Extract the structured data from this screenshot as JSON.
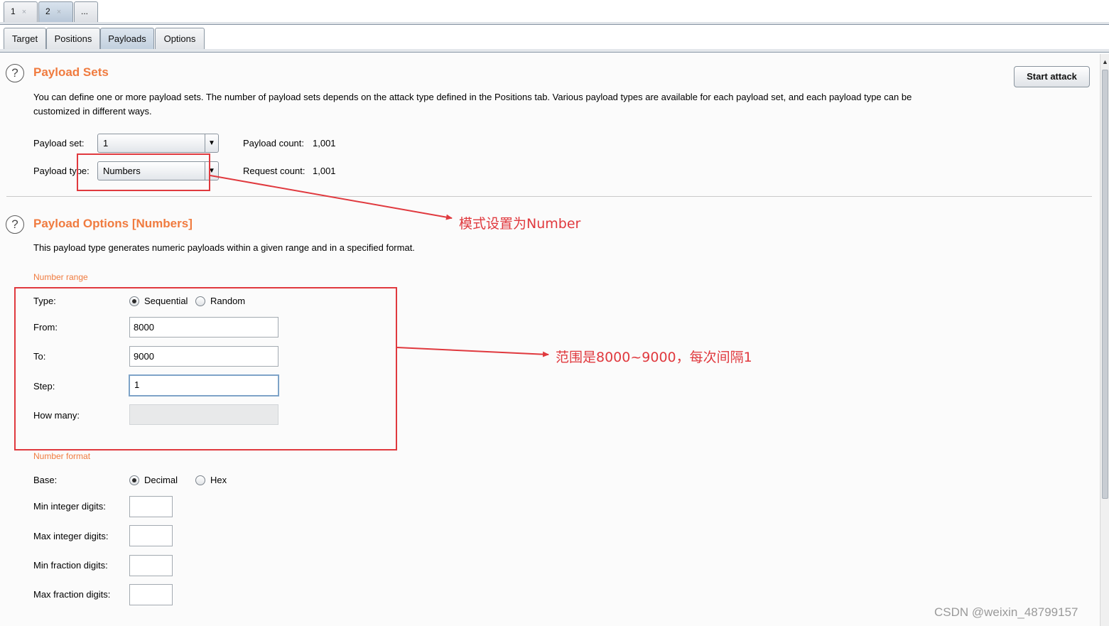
{
  "request_tabs": [
    {
      "label": "1",
      "close": "×"
    },
    {
      "label": "2",
      "close": "×",
      "active": true
    },
    {
      "label": "..."
    }
  ],
  "intruder_tabs": [
    {
      "label": "Target"
    },
    {
      "label": "Positions"
    },
    {
      "label": "Payloads",
      "active": true
    },
    {
      "label": "Options"
    }
  ],
  "payload_sets": {
    "title": "Payload Sets",
    "description_line1": "You can define one or more payload sets. The number of payload sets depends on the attack type defined in the Positions tab. Various payload types are available for each payload set, and each payload type can be",
    "description_line2": "customized in different ways.",
    "payload_set_label": "Payload set:",
    "payload_set_value": "1",
    "payload_type_label": "Payload type:",
    "payload_type_value": "Numbers",
    "payload_count_label": "Payload count:",
    "payload_count_value": "1,001",
    "request_count_label": "Request count:",
    "request_count_value": "1,001",
    "start_attack_label": "Start attack"
  },
  "payload_options": {
    "title": "Payload Options [Numbers]",
    "description": "This payload type generates numeric payloads within a given range and in a specified format.",
    "number_range_heading": "Number range",
    "type_label": "Type:",
    "type_options": [
      "Sequential",
      "Random"
    ],
    "type_selected": "Sequential",
    "from_label": "From:",
    "from_value": "8000",
    "to_label": "To:",
    "to_value": "9000",
    "step_label": "Step:",
    "step_value": "1",
    "how_many_label": "How many:",
    "how_many_value": "",
    "number_format_heading": "Number format",
    "base_label": "Base:",
    "base_options": [
      "Decimal",
      "Hex"
    ],
    "base_selected": "Decimal",
    "min_integer_label": "Min integer digits:",
    "max_integer_label": "Max integer digits:",
    "min_fraction_label": "Min fraction digits:",
    "max_fraction_label": "Max fraction digits:"
  },
  "annotations": {
    "mode_note": "模式设置为Number",
    "range_note": "范围是8000~9000，每次间隔1",
    "color": "#e0393e"
  },
  "watermark": "CSDN @weixin_48799157",
  "colors": {
    "section_title": "#f07b3f",
    "annotation": "#e0393e"
  }
}
